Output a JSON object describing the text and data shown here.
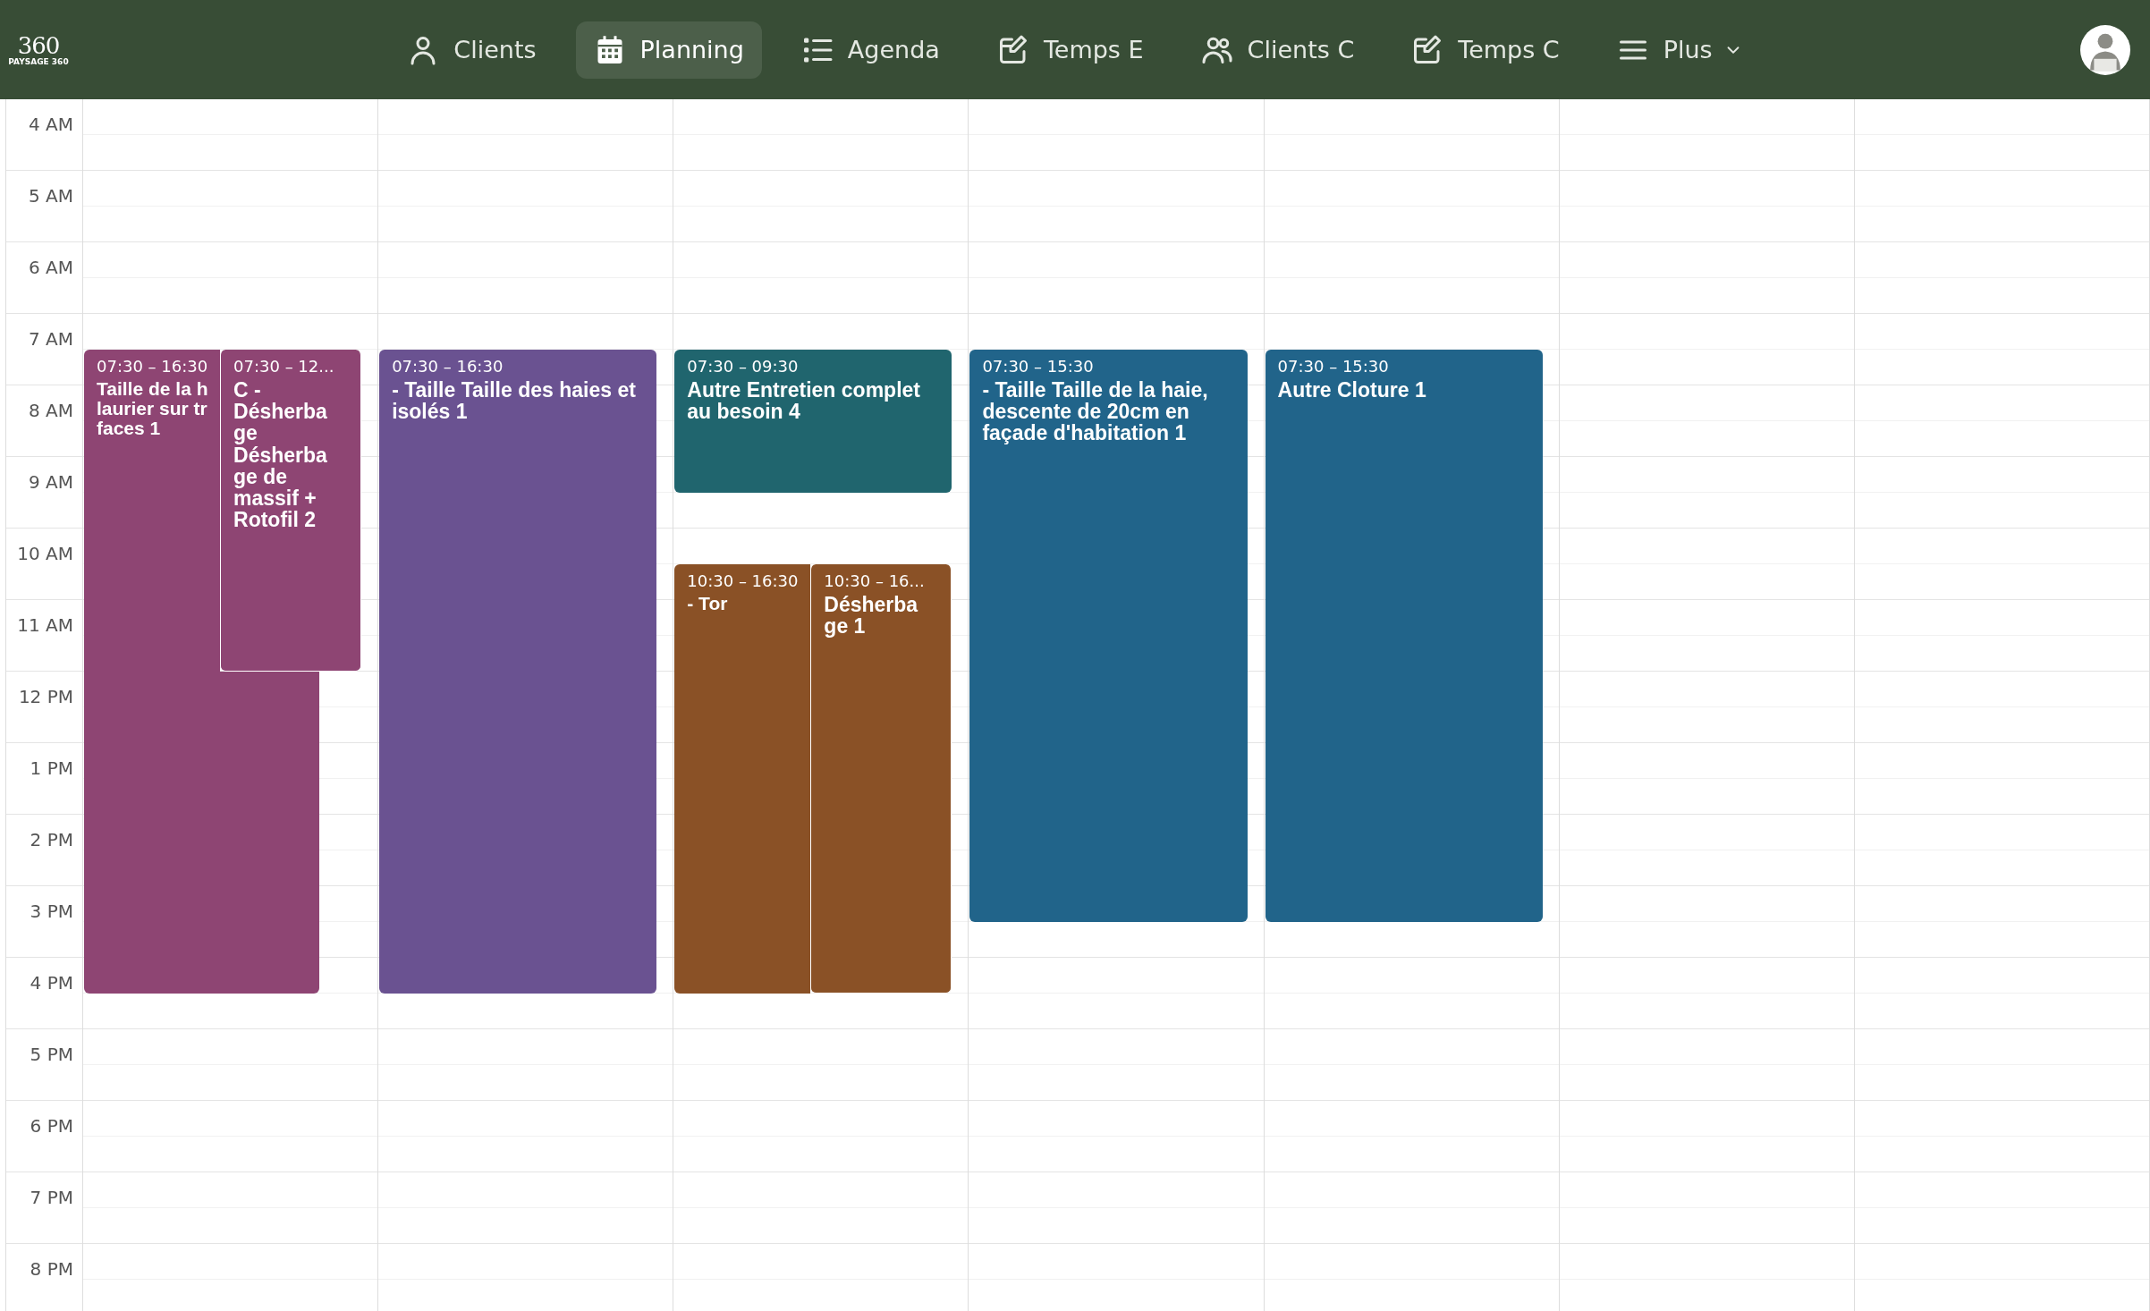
{
  "header": {
    "logo": "360",
    "logo_caption": "PAYSAGE 360",
    "nav": [
      {
        "label": "Clients",
        "selected": false
      },
      {
        "label": "Planning",
        "selected": true
      },
      {
        "label": "Agenda",
        "selected": false
      },
      {
        "label": "Temps E",
        "selected": false
      },
      {
        "label": "Clients C",
        "selected": false
      },
      {
        "label": "Temps C",
        "selected": false
      },
      {
        "label": "Plus",
        "selected": false
      }
    ]
  },
  "calendar": {
    "hours": [
      "4 AM",
      "5 AM",
      "6 AM",
      "7 AM",
      "8 AM",
      "9 AM",
      "10 AM",
      "11 AM",
      "12 PM",
      "1 PM",
      "2 PM",
      "3 PM",
      "4 PM",
      "5 PM",
      "6 PM",
      "7 PM",
      "8 PM"
    ],
    "days": [
      {
        "events": [
          {
            "time": "07:30 – 16:30",
            "color": "#8e4573",
            "title": "Taille de la h\nlaurier sur tr\nfaces 1"
          },
          {
            "time": "07:30 – 12...",
            "color": "#8e4573",
            "title": "C -\nDésherba\nge\nDésherba\nge de\nmassif +\nRotofil 2"
          }
        ]
      },
      {
        "events": [
          {
            "time": "07:30 – 16:30",
            "color": "#6a5291",
            "title": "- Taille Taille des haies et isolés 1"
          }
        ]
      },
      {
        "events": [
          {
            "time": "07:30 – 09:30",
            "color": "#20656e",
            "title": "Autre Entretien complet au besoin 4"
          },
          {
            "time": "10:30 – 16:30",
            "color": "#8a5126",
            "title": "- Tor"
          },
          {
            "time": "10:30 – 16...",
            "color": "#8a5126",
            "title": "Désherba\nge 1"
          }
        ]
      },
      {
        "events": [
          {
            "time": "07:30 – 15:30",
            "color": "#21648a",
            "title": "- Taille Taille de la haie, descente de 20cm en façade d'habitation 1"
          }
        ]
      },
      {
        "events": [
          {
            "time": "07:30 – 15:30",
            "color": "#21648a",
            "title": "Autre Cloture 1"
          }
        ]
      }
    ]
  }
}
